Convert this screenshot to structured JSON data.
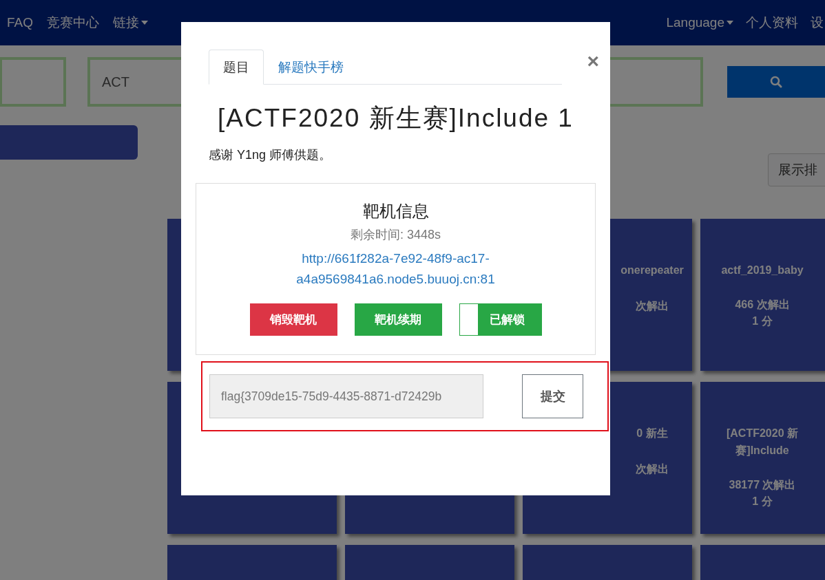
{
  "navbar": {
    "items": [
      {
        "label": "FAQ",
        "dropdown": false
      },
      {
        "label": "竞赛中心",
        "dropdown": false
      },
      {
        "label": "链接",
        "dropdown": true
      }
    ],
    "right_items": [
      {
        "label": "Language",
        "dropdown": true
      },
      {
        "label": "个人资料",
        "dropdown": false
      },
      {
        "label": "设",
        "dropdown": false
      }
    ]
  },
  "search": {
    "value": "ACT"
  },
  "sort_button": {
    "label": "展示排"
  },
  "card_rows": [
    [
      {
        "title": "onerepeater",
        "solves": "次解出"
      },
      {
        "title": "actf_2019_baby",
        "solves": "466 次解出",
        "points": "1 分"
      }
    ],
    [
      {
        "title": "0 新生",
        "solves": "次解出"
      },
      {
        "title": "[ACTF2020 新",
        "title_line_2": "赛]Include",
        "solves": "38177 次解出",
        "points": "1 分"
      }
    ]
  ],
  "modal": {
    "tabs": [
      {
        "label": "题目",
        "selected": true
      },
      {
        "label": "解题快手榜",
        "selected": false
      }
    ],
    "close": "×",
    "title": "[ACTF2020 新生赛]Include 1",
    "description": "感谢 Y1ng 师傅供题。",
    "target": {
      "heading": "靶机信息",
      "remaining": "剩余时间: 3448s",
      "url": "http://661f282a-7e92-48f9-ac17-a4a9569841a6.node5.buuoj.cn:81",
      "buttons": [
        {
          "label": "销毁靶机",
          "kind": "danger"
        },
        {
          "label": "靶机续期",
          "kind": "success"
        },
        {
          "label": "已解锁",
          "kind": "toggle",
          "unlocked": true
        }
      ]
    },
    "flag_form": {
      "value": "flag{3709de15-75d9-4435-8871-d72429b",
      "disabled": true,
      "submit": "提交",
      "highlighted": true
    }
  }
}
